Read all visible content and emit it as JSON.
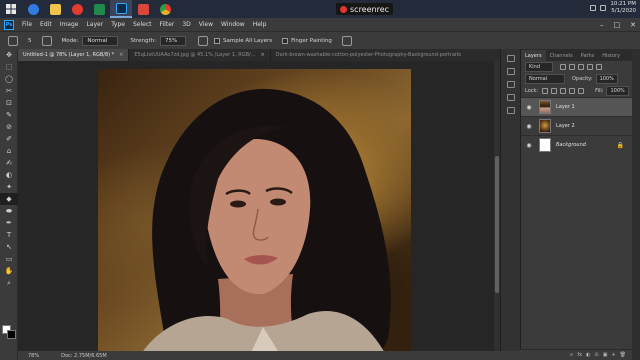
{
  "taskbar": {
    "apps": [
      {
        "name": "windows-start",
        "color": "#4aa3f0"
      },
      {
        "name": "internet-explorer",
        "color": "#2f7be0"
      },
      {
        "name": "file-explorer",
        "color": "#f2c34a"
      },
      {
        "name": "opera",
        "color": "#e33b2e"
      },
      {
        "name": "excel",
        "color": "#1f8a4c"
      },
      {
        "name": "photoshop",
        "color": "#31a8ff"
      },
      {
        "name": "screen-presenter",
        "color": "#d9473a"
      },
      {
        "name": "chrome",
        "color": "#e6b422"
      }
    ],
    "recorder_label": "screenrec",
    "time": "10:21 PM",
    "date": "5/1/2020"
  },
  "menu": {
    "logo": "Ps",
    "items": [
      "File",
      "Edit",
      "Image",
      "Layer",
      "Type",
      "Select",
      "Filter",
      "3D",
      "View",
      "Window",
      "Help"
    ],
    "window_controls": [
      "–",
      "□",
      "✕"
    ]
  },
  "options": {
    "brush_size": "5",
    "mode_label": "Mode:",
    "mode_value": "Normal",
    "strength_label": "Strength:",
    "strength_value": "75%",
    "sample_all_layers": "Sample All Layers",
    "finger_painting": "Finger Painting"
  },
  "tools": [
    "✥",
    "⬚",
    "◯",
    "✂",
    "⊡",
    "✎",
    "⊘",
    "✐",
    "⌂",
    "✍",
    "◐",
    "✦",
    "◆",
    "⬬",
    "✒",
    "T",
    "↖",
    "▭",
    "✋",
    "⌕"
  ],
  "doc_tabs": [
    {
      "label": "Untitled-1 @ 78% (Layer 1, RGB/8) *",
      "active": true
    },
    {
      "label": "E5qLtstUUAAo7zd.jpg @ 45.1% (Layer 1, RGB/...",
      "active": false
    },
    {
      "label": "Dark-brown-washable-cotton-polyester-Photography-Background-portraits",
      "active": false
    }
  ],
  "status": {
    "zoom": "78%",
    "doc_size": "Doc: 2.75M/6.65M"
  },
  "layers_panel": {
    "tabs": [
      "Layers",
      "Channels",
      "Paths",
      "History"
    ],
    "filter_kind": "Kind",
    "blend_mode": "Normal",
    "opacity_label": "Opacity:",
    "opacity_value": "100%",
    "lock_label": "Lock:",
    "fill_label": "Fill:",
    "fill_value": "100%",
    "layers": [
      {
        "name": "Layer 1",
        "selected": true,
        "thumb": "l1"
      },
      {
        "name": "Layer 2",
        "selected": false,
        "thumb": "l2"
      },
      {
        "name": "Background",
        "selected": false,
        "thumb": "bg",
        "locked": true
      }
    ],
    "bottom_icons": [
      "∞",
      "fx",
      "◐",
      "⊙",
      "▣",
      "+",
      "🗑"
    ]
  }
}
